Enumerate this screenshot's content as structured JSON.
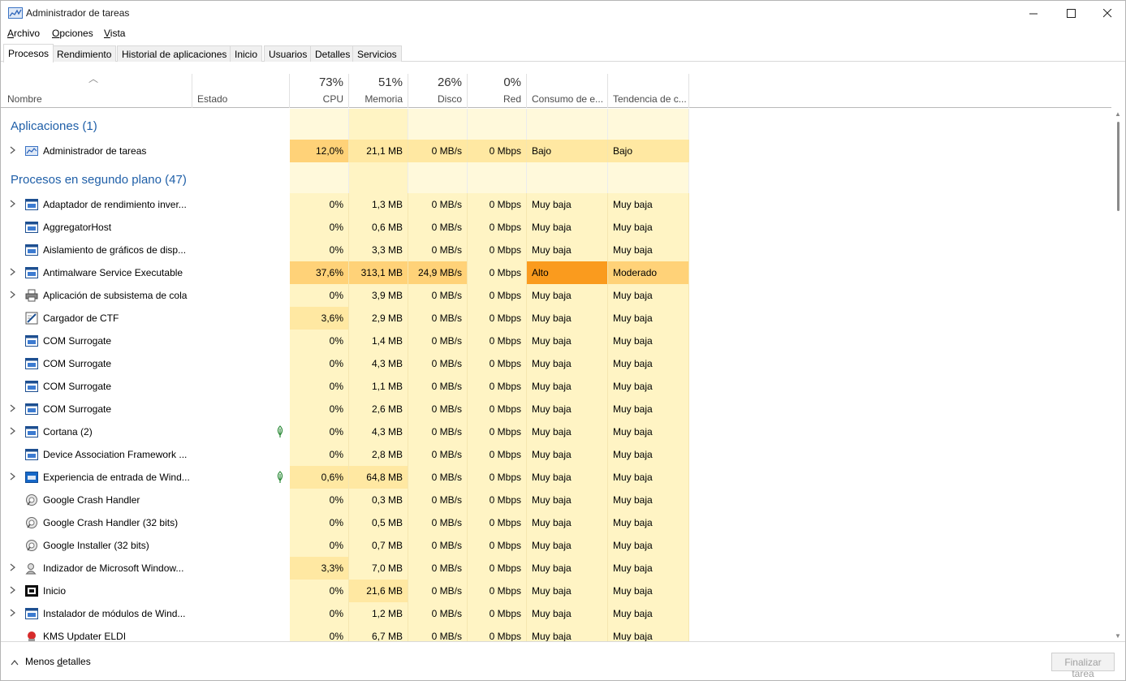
{
  "window": {
    "title": "Administrador de tareas"
  },
  "menu": [
    {
      "label_u": "A",
      "label_rest": "rchivo"
    },
    {
      "label_u": "O",
      "label_rest": "pciones"
    },
    {
      "label_u": "V",
      "label_rest": "ista"
    }
  ],
  "tabs": [
    "Procesos",
    "Rendimiento",
    "Historial de aplicaciones",
    "Inicio",
    "Usuarios",
    "Detalles",
    "Servicios"
  ],
  "columns": {
    "name": "Nombre",
    "status": "Estado",
    "cpu": {
      "pct": "73%",
      "label": "CPU"
    },
    "mem": {
      "pct": "51%",
      "label": "Memoria"
    },
    "disk": {
      "pct": "26%",
      "label": "Disco"
    },
    "net": {
      "pct": "0%",
      "label": "Red"
    },
    "power": "Consumo de e...",
    "trend": "Tendencia de c..."
  },
  "groups": {
    "apps": "Aplicaciones (1)",
    "background": "Procesos en segundo plano (47)"
  },
  "app_rows": [
    {
      "name": "Administrador de tareas",
      "icon": "task-manager-icon",
      "expand": true,
      "cpu": "12,0%",
      "mem": "21,1 MB",
      "disk": "0 MB/s",
      "net": "0 Mbps",
      "power": "Bajo",
      "trend": "Bajo"
    }
  ],
  "bg_rows": [
    {
      "name": "Adaptador de rendimiento inver...",
      "icon": "service-window-icon",
      "expand": true,
      "cpu": "0%",
      "mem": "1,3 MB",
      "disk": "0 MB/s",
      "net": "0 Mbps",
      "power": "Muy baja",
      "trend": "Muy baja"
    },
    {
      "name": "AggregatorHost",
      "icon": "service-window-icon",
      "expand": false,
      "cpu": "0%",
      "mem": "0,6 MB",
      "disk": "0 MB/s",
      "net": "0 Mbps",
      "power": "Muy baja",
      "trend": "Muy baja"
    },
    {
      "name": "Aislamiento de gráficos de disp...",
      "icon": "service-window-icon",
      "expand": false,
      "cpu": "0%",
      "mem": "3,3 MB",
      "disk": "0 MB/s",
      "net": "0 Mbps",
      "power": "Muy baja",
      "trend": "Muy baja"
    },
    {
      "name": "Antimalware Service Executable",
      "icon": "service-window-icon",
      "expand": true,
      "cpu": "37,6%",
      "mem": "313,1 MB",
      "disk": "24,9 MB/s",
      "net": "0 Mbps",
      "power": "Alto",
      "trend": "Moderado",
      "hot": true
    },
    {
      "name": "Aplicación de subsistema de cola",
      "icon": "printer-icon",
      "expand": true,
      "cpu": "0%",
      "mem": "3,9 MB",
      "disk": "0 MB/s",
      "net": "0 Mbps",
      "power": "Muy baja",
      "trend": "Muy baja"
    },
    {
      "name": "Cargador de CTF",
      "icon": "pen-icon",
      "expand": false,
      "cpu": "3,6%",
      "mem": "2,9 MB",
      "disk": "0 MB/s",
      "net": "0 Mbps",
      "power": "Muy baja",
      "trend": "Muy baja"
    },
    {
      "name": "COM Surrogate",
      "icon": "service-window-icon",
      "expand": false,
      "cpu": "0%",
      "mem": "1,4 MB",
      "disk": "0 MB/s",
      "net": "0 Mbps",
      "power": "Muy baja",
      "trend": "Muy baja"
    },
    {
      "name": "COM Surrogate",
      "icon": "service-window-icon",
      "expand": false,
      "cpu": "0%",
      "mem": "4,3 MB",
      "disk": "0 MB/s",
      "net": "0 Mbps",
      "power": "Muy baja",
      "trend": "Muy baja"
    },
    {
      "name": "COM Surrogate",
      "icon": "service-window-icon",
      "expand": false,
      "cpu": "0%",
      "mem": "1,1 MB",
      "disk": "0 MB/s",
      "net": "0 Mbps",
      "power": "Muy baja",
      "trend": "Muy baja"
    },
    {
      "name": "COM Surrogate",
      "icon": "service-window-icon",
      "expand": true,
      "cpu": "0%",
      "mem": "2,6 MB",
      "disk": "0 MB/s",
      "net": "0 Mbps",
      "power": "Muy baja",
      "trend": "Muy baja"
    },
    {
      "name": "Cortana (2)",
      "icon": "service-window-icon",
      "expand": true,
      "leaf": true,
      "cpu": "0%",
      "mem": "4,3 MB",
      "disk": "0 MB/s",
      "net": "0 Mbps",
      "power": "Muy baja",
      "trend": "Muy baja"
    },
    {
      "name": "Device Association Framework ...",
      "icon": "service-window-icon",
      "expand": false,
      "cpu": "0%",
      "mem": "2,8 MB",
      "disk": "0 MB/s",
      "net": "0 Mbps",
      "power": "Muy baja",
      "trend": "Muy baja"
    },
    {
      "name": "Experiencia de entrada de Wind...",
      "icon": "keyboard-blue-icon",
      "expand": true,
      "leaf": true,
      "cpu": "0,6%",
      "mem": "64,8 MB",
      "disk": "0 MB/s",
      "net": "0 Mbps",
      "power": "Muy baja",
      "trend": "Muy baja"
    },
    {
      "name": "Google Crash Handler",
      "icon": "google-installer-icon",
      "expand": false,
      "cpu": "0%",
      "mem": "0,3 MB",
      "disk": "0 MB/s",
      "net": "0 Mbps",
      "power": "Muy baja",
      "trend": "Muy baja"
    },
    {
      "name": "Google Crash Handler (32 bits)",
      "icon": "google-installer-icon",
      "expand": false,
      "cpu": "0%",
      "mem": "0,5 MB",
      "disk": "0 MB/s",
      "net": "0 Mbps",
      "power": "Muy baja",
      "trend": "Muy baja"
    },
    {
      "name": "Google Installer (32 bits)",
      "icon": "google-installer-icon",
      "expand": false,
      "cpu": "0%",
      "mem": "0,7 MB",
      "disk": "0 MB/s",
      "net": "0 Mbps",
      "power": "Muy baja",
      "trend": "Muy baja"
    },
    {
      "name": "Indizador de Microsoft Window...",
      "icon": "search-user-icon",
      "expand": true,
      "cpu": "3,3%",
      "mem": "7,0 MB",
      "disk": "0 MB/s",
      "net": "0 Mbps",
      "power": "Muy baja",
      "trend": "Muy baja"
    },
    {
      "name": "Inicio",
      "icon": "start-black-icon",
      "expand": true,
      "cpu": "0%",
      "mem": "21,6 MB",
      "disk": "0 MB/s",
      "net": "0 Mbps",
      "power": "Muy baja",
      "trend": "Muy baja"
    },
    {
      "name": "Instalador de módulos de Wind...",
      "icon": "service-window-icon",
      "expand": true,
      "cpu": "0%",
      "mem": "1,2 MB",
      "disk": "0 MB/s",
      "net": "0 Mbps",
      "power": "Muy baja",
      "trend": "Muy baja"
    },
    {
      "name": "KMS Updater ELDI",
      "icon": "kms-red-icon",
      "expand": false,
      "cpu": "0%",
      "mem": "6,7 MB",
      "disk": "0 MB/s",
      "net": "0 Mbps",
      "power": "Muy baja",
      "trend": "Muy baja"
    }
  ],
  "footer": {
    "less_u": "d",
    "less_pre": "Menos ",
    "less_post": "etalles",
    "end_task": "Finalizar tarea"
  },
  "colors": {
    "link_blue": "#1f5fa8",
    "cell_low": "#fff4c4",
    "cell_med": "#ffe8a2",
    "cell_hot": "#ffd278",
    "cell_high": "#fa9b1e"
  }
}
